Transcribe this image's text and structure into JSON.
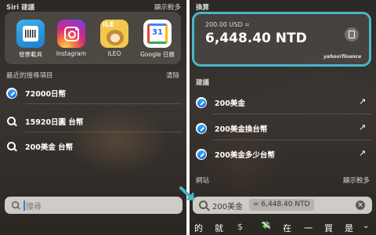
{
  "left": {
    "siri_header": "Siri 建議",
    "siri_more": "顯示較多",
    "apps": [
      {
        "label": "發票載具",
        "icon": "invoice-app-icon"
      },
      {
        "label": "Instagram",
        "icon": "instagram-icon"
      },
      {
        "label": "iLEO",
        "icon": "ileo-app-icon"
      },
      {
        "label": "Google 日曆",
        "icon": "google-calendar-icon"
      }
    ],
    "ileo_text": "iLE",
    "calendar_day": "31",
    "recent_header": "最近的搜尋項目",
    "recent_clear": "清除",
    "recents": [
      {
        "label": "72000日幣",
        "icon": "safari-icon"
      },
      {
        "label": "15920日圓 台幣",
        "icon": "search-icon"
      },
      {
        "label": "200美金 台幣",
        "icon": "search-icon"
      }
    ],
    "search_placeholder": "搜尋"
  },
  "right": {
    "calc_header": "換算",
    "calc_from": "200.00 USD =",
    "calc_result": "6,448.40 NTD",
    "calc_source": "yahoo!finance",
    "suggest_header": "建議",
    "suggestions": [
      {
        "label": "200美金",
        "icon": "safari-icon"
      },
      {
        "label": "200美金換台幣",
        "icon": "safari-icon"
      },
      {
        "label": "200美金多少台幣",
        "icon": "safari-icon"
      }
    ],
    "web_header": "網站",
    "web_more": "顯示較多",
    "search_query": "200美金",
    "search_inline_result": "= 6,448.40 NTD",
    "keyboard_suggestions": [
      "的",
      "就",
      "$",
      "💸",
      "在",
      "一",
      "買",
      "是"
    ]
  },
  "colors": {
    "highlight": "#49b6c6",
    "divider": "#f2f2f2"
  }
}
